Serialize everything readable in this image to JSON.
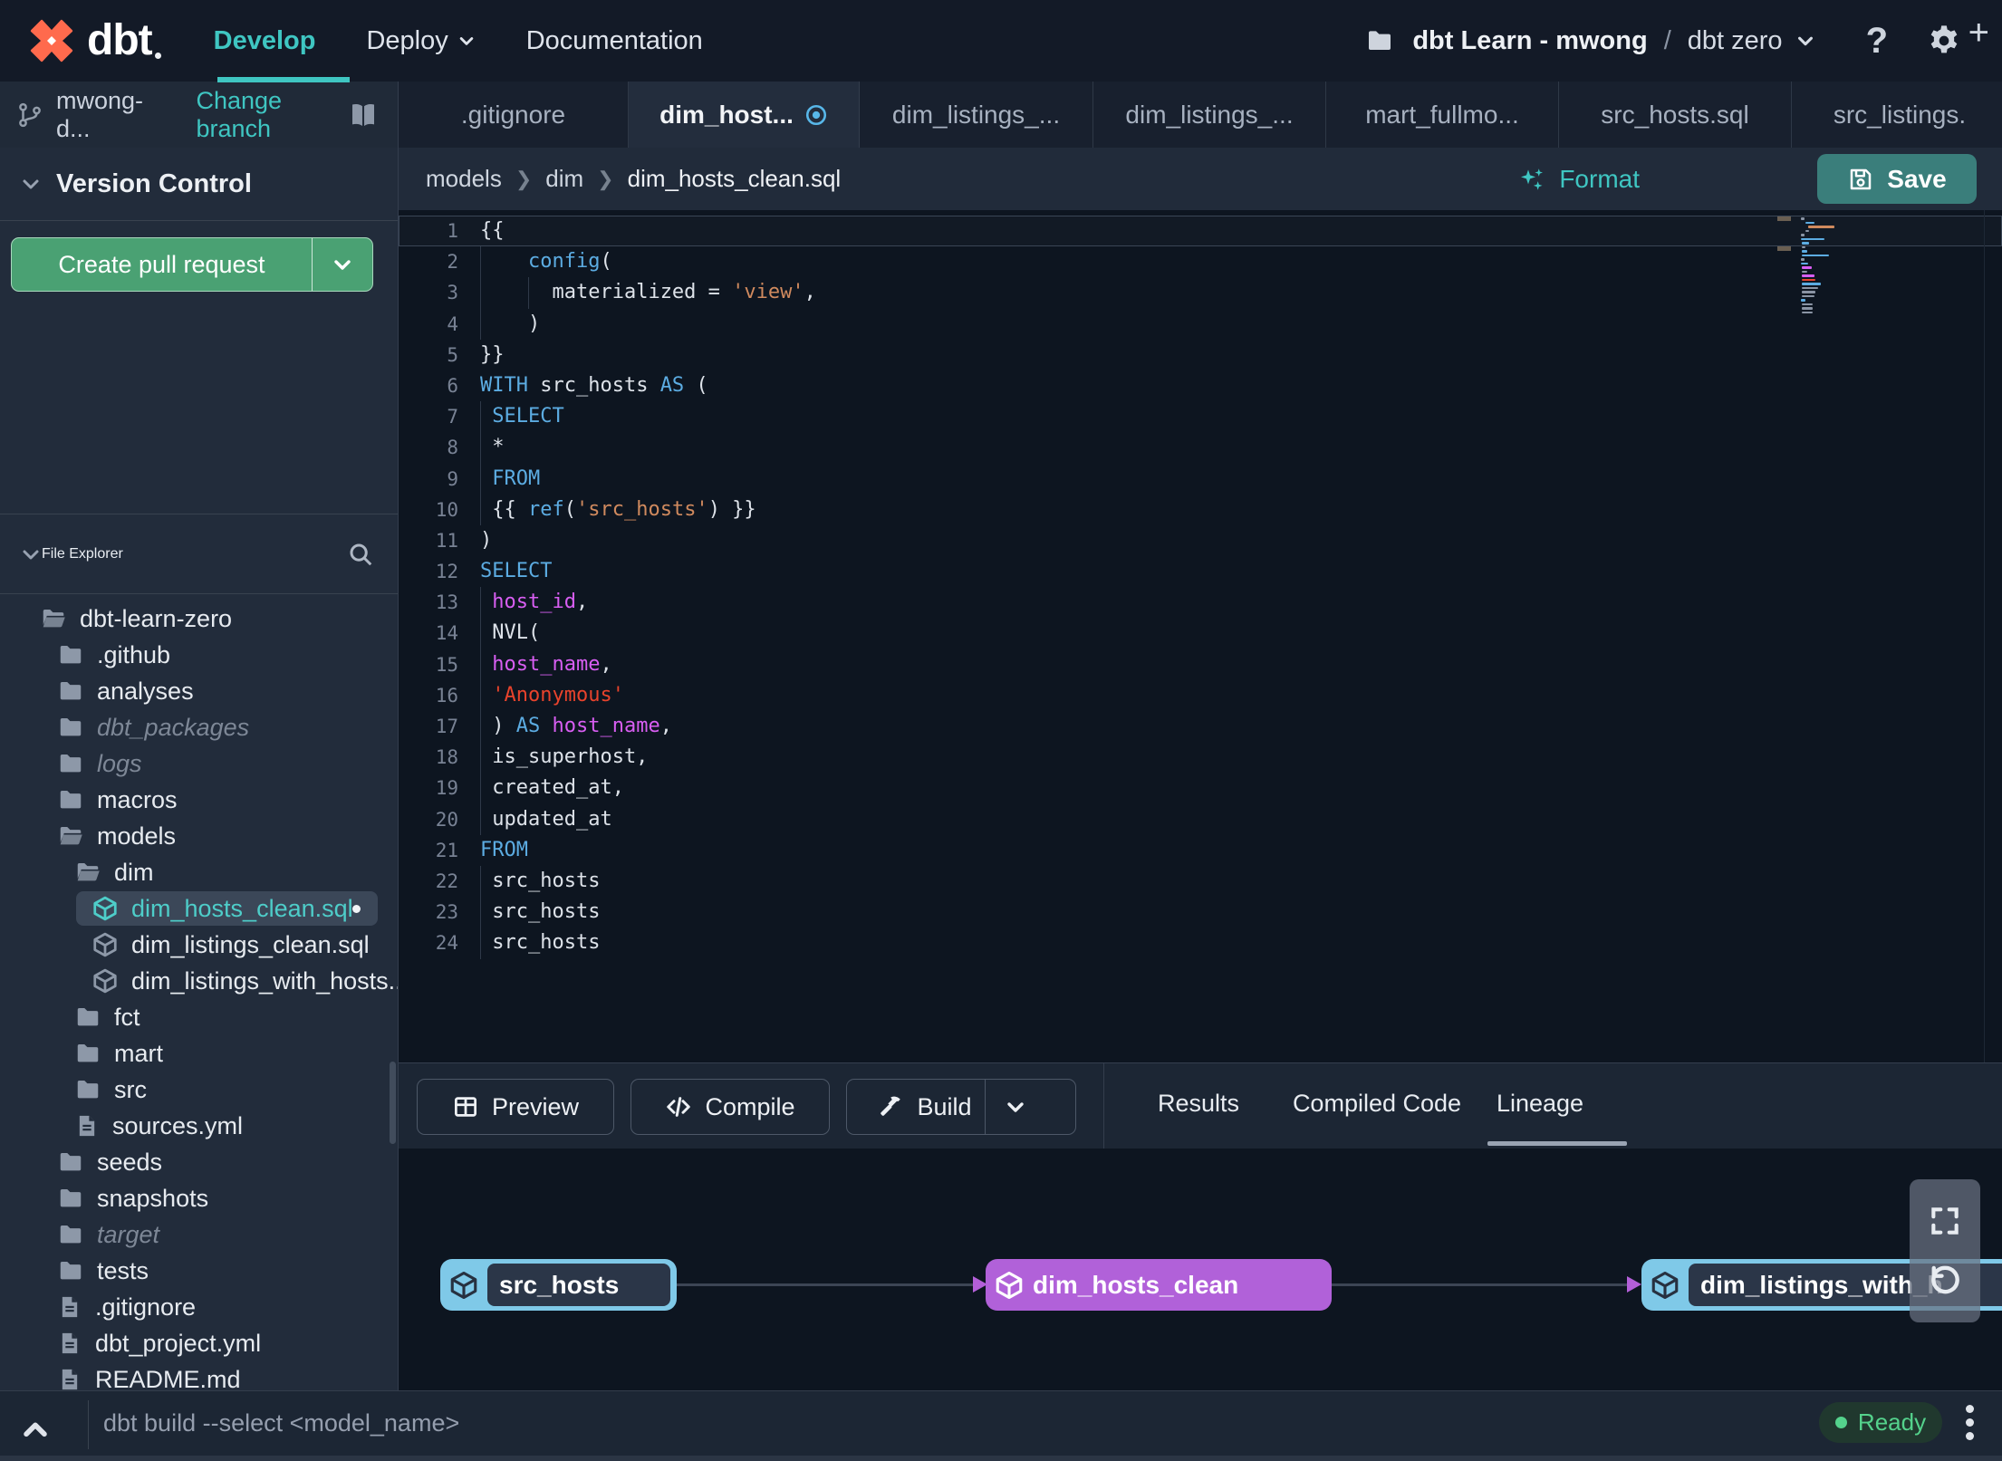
{
  "navbar": {
    "logo": "dbt",
    "items": [
      {
        "label": "Develop",
        "active": true,
        "caret": false
      },
      {
        "label": "Deploy",
        "active": false,
        "caret": true
      },
      {
        "label": "Documentation",
        "active": false,
        "caret": false
      }
    ],
    "project": "dbt Learn - mwong",
    "separator": "/",
    "environment": "dbt zero",
    "help": "?"
  },
  "branch_bar": {
    "branch": "mwong-d...",
    "change_branch": "Change branch"
  },
  "tabs": [
    {
      "label": ".gitignore",
      "active": false,
      "modified": false
    },
    {
      "label": "dim_host...",
      "active": true,
      "modified": true
    },
    {
      "label": "dim_listings_...",
      "active": false,
      "modified": false
    },
    {
      "label": "dim_listings_...",
      "active": false,
      "modified": false
    },
    {
      "label": "mart_fullmo...",
      "active": false,
      "modified": false
    },
    {
      "label": "src_hosts.sql",
      "active": false,
      "modified": false
    },
    {
      "label": "src_listings.",
      "active": false,
      "modified": false
    }
  ],
  "new_tab": "+",
  "breadcrumb": [
    "models",
    "dim",
    "dim_hosts_clean.sql"
  ],
  "editor_actions": {
    "format": "Format",
    "save": "Save"
  },
  "version_control": {
    "title": "Version Control",
    "create_pr": "Create pull request"
  },
  "file_explorer": {
    "title": "File Explorer"
  },
  "file_tree": [
    {
      "label": "dbt-learn-zero",
      "type": "folder-open",
      "level": 0,
      "muted": false,
      "selected": false,
      "dot": false
    },
    {
      "label": ".github",
      "type": "folder",
      "level": 1,
      "muted": false,
      "selected": false,
      "dot": false
    },
    {
      "label": "analyses",
      "type": "folder",
      "level": 1,
      "muted": false,
      "selected": false,
      "dot": false
    },
    {
      "label": "dbt_packages",
      "type": "folder",
      "level": 1,
      "muted": true,
      "selected": false,
      "dot": false
    },
    {
      "label": "logs",
      "type": "folder",
      "level": 1,
      "muted": true,
      "selected": false,
      "dot": false
    },
    {
      "label": "macros",
      "type": "folder",
      "level": 1,
      "muted": false,
      "selected": false,
      "dot": false
    },
    {
      "label": "models",
      "type": "folder-open",
      "level": 1,
      "muted": false,
      "selected": false,
      "dot": false
    },
    {
      "label": "dim",
      "type": "folder-open",
      "level": 2,
      "muted": false,
      "selected": false,
      "dot": false
    },
    {
      "label": "dim_hosts_clean.sql",
      "type": "model",
      "level": 3,
      "muted": false,
      "selected": true,
      "dot": true
    },
    {
      "label": "dim_listings_clean.sql",
      "type": "model",
      "level": 3,
      "muted": false,
      "selected": false,
      "dot": false
    },
    {
      "label": "dim_listings_with_hosts...",
      "type": "model",
      "level": 3,
      "muted": false,
      "selected": false,
      "dot": false
    },
    {
      "label": "fct",
      "type": "folder",
      "level": 2,
      "muted": false,
      "selected": false,
      "dot": false
    },
    {
      "label": "mart",
      "type": "folder",
      "level": 2,
      "muted": false,
      "selected": false,
      "dot": false
    },
    {
      "label": "src",
      "type": "folder",
      "level": 2,
      "muted": false,
      "selected": false,
      "dot": false
    },
    {
      "label": "sources.yml",
      "type": "file",
      "level": 2,
      "muted": false,
      "selected": false,
      "dot": false
    },
    {
      "label": "seeds",
      "type": "folder",
      "level": 1,
      "muted": false,
      "selected": false,
      "dot": false
    },
    {
      "label": "snapshots",
      "type": "folder",
      "level": 1,
      "muted": false,
      "selected": false,
      "dot": false
    },
    {
      "label": "target",
      "type": "folder",
      "level": 1,
      "muted": true,
      "selected": false,
      "dot": false
    },
    {
      "label": "tests",
      "type": "folder",
      "level": 1,
      "muted": false,
      "selected": false,
      "dot": false
    },
    {
      "label": ".gitignore",
      "type": "file",
      "level": 1,
      "muted": false,
      "selected": false,
      "dot": false
    },
    {
      "label": "dbt_project.yml",
      "type": "file",
      "level": 1,
      "muted": false,
      "selected": false,
      "dot": false
    },
    {
      "label": "README.md",
      "type": "file",
      "level": 1,
      "muted": false,
      "selected": false,
      "dot": false
    }
  ],
  "code": {
    "lines": [
      {
        "n": 1,
        "active": true,
        "tokens": [
          [
            "{{",
            "pl"
          ]
        ]
      },
      {
        "n": 2,
        "tokens": [
          [
            "    ",
            "pl"
          ],
          [
            "config",
            "kw"
          ],
          [
            "(",
            "pl"
          ]
        ]
      },
      {
        "n": 3,
        "tokens": [
          [
            "      ",
            "pl"
          ],
          [
            "materialized = ",
            "pl"
          ],
          [
            "'view'",
            "str"
          ],
          [
            ",",
            "pl"
          ]
        ]
      },
      {
        "n": 4,
        "tokens": [
          [
            "    )",
            "pl"
          ]
        ]
      },
      {
        "n": 5,
        "tokens": [
          [
            "}}",
            "pl"
          ]
        ]
      },
      {
        "n": 6,
        "tokens": [
          [
            "WITH",
            "kw"
          ],
          [
            " src_hosts ",
            "pl"
          ],
          [
            "AS",
            "kw"
          ],
          [
            " (",
            "pl"
          ]
        ]
      },
      {
        "n": 7,
        "tokens": [
          [
            " ",
            "pl"
          ],
          [
            "SELECT",
            "kw"
          ]
        ]
      },
      {
        "n": 8,
        "tokens": [
          [
            " *",
            "pl"
          ]
        ]
      },
      {
        "n": 9,
        "tokens": [
          [
            " ",
            "pl"
          ],
          [
            "FROM",
            "kw"
          ]
        ]
      },
      {
        "n": 10,
        "tokens": [
          [
            " {{ ",
            "pl"
          ],
          [
            "ref",
            "kw"
          ],
          [
            "(",
            "pl"
          ],
          [
            "'src_hosts'",
            "str"
          ],
          [
            ") }}",
            "pl"
          ]
        ]
      },
      {
        "n": 11,
        "tokens": [
          [
            ")",
            "pl"
          ]
        ]
      },
      {
        "n": 12,
        "tokens": [
          [
            "SELECT",
            "kw"
          ]
        ]
      },
      {
        "n": 13,
        "tokens": [
          [
            " ",
            "pl"
          ],
          [
            "host_id",
            "id"
          ],
          [
            ",",
            "pl"
          ]
        ]
      },
      {
        "n": 14,
        "tokens": [
          [
            " NVL(",
            "pl"
          ]
        ]
      },
      {
        "n": 15,
        "tokens": [
          [
            " ",
            "pl"
          ],
          [
            "host_name",
            "id"
          ],
          [
            ",",
            "pl"
          ]
        ]
      },
      {
        "n": 16,
        "tokens": [
          [
            " ",
            "pl"
          ],
          [
            "'Anonymous'",
            "strr"
          ]
        ]
      },
      {
        "n": 17,
        "tokens": [
          [
            " ) ",
            "pl"
          ],
          [
            "AS",
            "kw"
          ],
          [
            " ",
            "pl"
          ],
          [
            "host_name",
            "id"
          ],
          [
            ",",
            "pl"
          ]
        ]
      },
      {
        "n": 18,
        "tokens": [
          [
            " is_superhost,",
            "pl"
          ]
        ]
      },
      {
        "n": 19,
        "tokens": [
          [
            " created_at,",
            "pl"
          ]
        ]
      },
      {
        "n": 20,
        "tokens": [
          [
            " updated_at",
            "pl"
          ]
        ]
      },
      {
        "n": 21,
        "tokens": [
          [
            "FROM",
            "kw"
          ]
        ]
      },
      {
        "n": 22,
        "tokens": [
          [
            " src_hosts",
            "pl"
          ]
        ]
      },
      {
        "n": 23,
        "tokens": [
          [
            " src_hosts",
            "pl"
          ]
        ]
      },
      {
        "n": 24,
        "tokens": [
          [
            " src_hosts",
            "pl"
          ]
        ]
      }
    ],
    "guides": [
      {
        "col": 0,
        "from": 2,
        "to": 4
      },
      {
        "col": 4,
        "from": 3,
        "to": 3
      },
      {
        "col": 0,
        "from": 7,
        "to": 10
      },
      {
        "col": 0,
        "from": 13,
        "to": 20
      },
      {
        "col": 0,
        "from": 22,
        "to": 24
      }
    ]
  },
  "bottom_bar": {
    "buttons": [
      {
        "label": "Preview",
        "icon": "grid",
        "split": false
      },
      {
        "label": "Compile",
        "icon": "code",
        "split": false
      },
      {
        "label": "Build",
        "icon": "hammer",
        "split": true
      }
    ],
    "tabs": [
      {
        "label": "Results",
        "active": false
      },
      {
        "label": "Compiled Code",
        "active": false
      },
      {
        "label": "Lineage",
        "active": true
      }
    ]
  },
  "lineage": {
    "nodes": [
      {
        "label": "src_hosts",
        "variant": "source"
      },
      {
        "label": "dim_hosts_clean",
        "variant": "model"
      },
      {
        "label": "dim_listings_with_h",
        "variant": "source"
      }
    ]
  },
  "status_bar": {
    "placeholder": "dbt build --select <model_name>",
    "status": "Ready"
  },
  "colors": {
    "accent_teal": "#3fc6c2",
    "save_green": "#3a7e7b",
    "pr_green": "#4aa173",
    "node_blue": "#7fc9e8",
    "node_purple": "#b161d9",
    "status_green": "#54d28c",
    "modified_blue": "#58b7e9",
    "string_orange": "#d08a5e",
    "string_red": "#e8432c",
    "keyword_blue": "#5cace2",
    "identifier_magenta": "#d85ef2",
    "logo_orange": "#ff6a4d"
  }
}
